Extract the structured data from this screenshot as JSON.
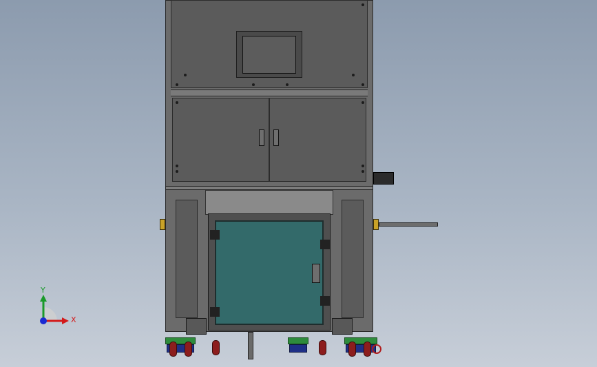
{
  "viewport": {
    "background_top": "#8c9bae",
    "background_bottom": "#c7ced8"
  },
  "machine": {
    "body_color": "#5b5b5b",
    "frame_color": "#6b6b6b",
    "glass_door_color": "#336a6a",
    "caster_colors": {
      "wheel": "#8c1d1d",
      "top": "#2e8b3c",
      "base": "#1e2f86"
    }
  },
  "triad": {
    "x_label": "X",
    "y_label": "Y",
    "x_color": "#d31a1a",
    "y_color": "#1a9a2a",
    "z_color": "#1a2ad3"
  }
}
